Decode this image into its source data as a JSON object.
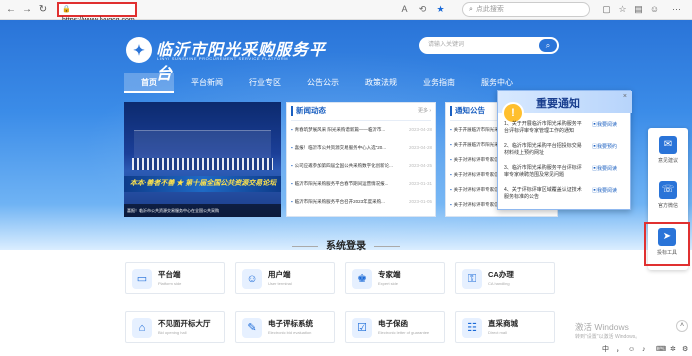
{
  "browser": {
    "url": "https://www.lyygcg.com",
    "search_placeholder": "点此搜索",
    "back_icon": "back-arrow-icon",
    "refresh_icon": "refresh-icon"
  },
  "site": {
    "title": "临沂市阳光采购服务平台",
    "subtitle": "LINYI SUNSHINE PROCUREMENT SERVICE PLATFORM",
    "search_placeholder": "请输入关键词"
  },
  "nav": [
    {
      "label": "首页"
    },
    {
      "label": "平台新闻"
    },
    {
      "label": "行业专区"
    },
    {
      "label": "公告公示"
    },
    {
      "label": "政策法规"
    },
    {
      "label": "业务指南"
    },
    {
      "label": "服务中心"
    }
  ],
  "banner": {
    "band_text": "本本·善者不善 ★ 第十届全国公共资源交易论坛",
    "caption": "喜报！临沂市公共资源交易服务中心在全国公共采购"
  },
  "news": {
    "title": "新闻动态",
    "more": "更多 ›",
    "items": [
      {
        "text": "青春筑梦展风采 阳光采购谱新篇——临沂市...",
        "date": "2023-04-28"
      },
      {
        "text": "喜报！临沂市公共资源交易服务中心入选\"20...",
        "date": "2023-04-28"
      },
      {
        "text": "公司应邀参加第四届全国公共采购数字化创新论...",
        "date": "2023-04-25"
      },
      {
        "text": "临沂市阳光采购服务平台春节期间运营情况报...",
        "date": "2023-01-31"
      },
      {
        "text": "临沂市阳光采购服务平台召开2023年度采购...",
        "date": "2023-01-05"
      }
    ]
  },
  "notice": {
    "title": "通知公告",
    "items": [
      {
        "text": "关于开展临沂市阳光采购服务...",
        "date": ""
      },
      {
        "text": "关于开展临沂市阳光采购服务...",
        "date": ""
      },
      {
        "text": "关于对评标评审专家信用...",
        "date": ""
      },
      {
        "text": "关于对评标评审专家信用...",
        "date": ""
      },
      {
        "text": "关于对评标评审专家信用评价结果...",
        "date": "2022-09-08"
      },
      {
        "text": "关于对评标评审专家信用评价结果...",
        "date": "2022-09-08"
      }
    ]
  },
  "popup": {
    "title": "重要通知",
    "close": "×",
    "items": [
      {
        "text": "1、关于开展临沂市阳光采购服务平台评标评审专家管理工作的通知",
        "link": "我要阅读"
      },
      {
        "text": "2、临沂市阳光采购平台招投标交易材料线上预约网址",
        "link": "我要预约"
      },
      {
        "text": "3、临沂市阳光采购服务平台评标评审专家续聘范围及常见问题",
        "link": "我要阅读"
      },
      {
        "text": "4、关于评标评审区域覆盖认证技术服务标准的公告",
        "link": "我要阅读"
      }
    ]
  },
  "section": {
    "title": "系统登录"
  },
  "cards": [
    {
      "title": "平台端",
      "sub": "Platform side",
      "icon": "monitor-icon"
    },
    {
      "title": "用户端",
      "sub": "User terminal",
      "icon": "user-icon"
    },
    {
      "title": "专家端",
      "sub": "Expert side",
      "icon": "expert-icon"
    },
    {
      "title": "CA办理",
      "sub": "CA handling",
      "icon": "ca-icon"
    },
    {
      "title": "不见面开标大厅",
      "sub": "Bid opening hall",
      "icon": "hall-icon"
    },
    {
      "title": "电子评标系统",
      "sub": "Electronic bid evaluation",
      "icon": "evaluation-icon"
    },
    {
      "title": "电子保函",
      "sub": "Electronic letter of guarantee",
      "icon": "guarantee-icon"
    },
    {
      "title": "直采商城",
      "sub": "Direct mall",
      "icon": "mall-icon"
    }
  ],
  "float": [
    {
      "label": "意见建议",
      "icon": "chat-icon"
    },
    {
      "label": "官方微信",
      "icon": "wechat-icon"
    },
    {
      "label": "投标工具",
      "icon": "paper-plane-icon"
    }
  ],
  "windows_watermark": {
    "line1": "激活 Windows",
    "line2": "转到\"设置\"以激活 Windows。"
  },
  "ime": {
    "lang": "中",
    "punct": "，"
  }
}
